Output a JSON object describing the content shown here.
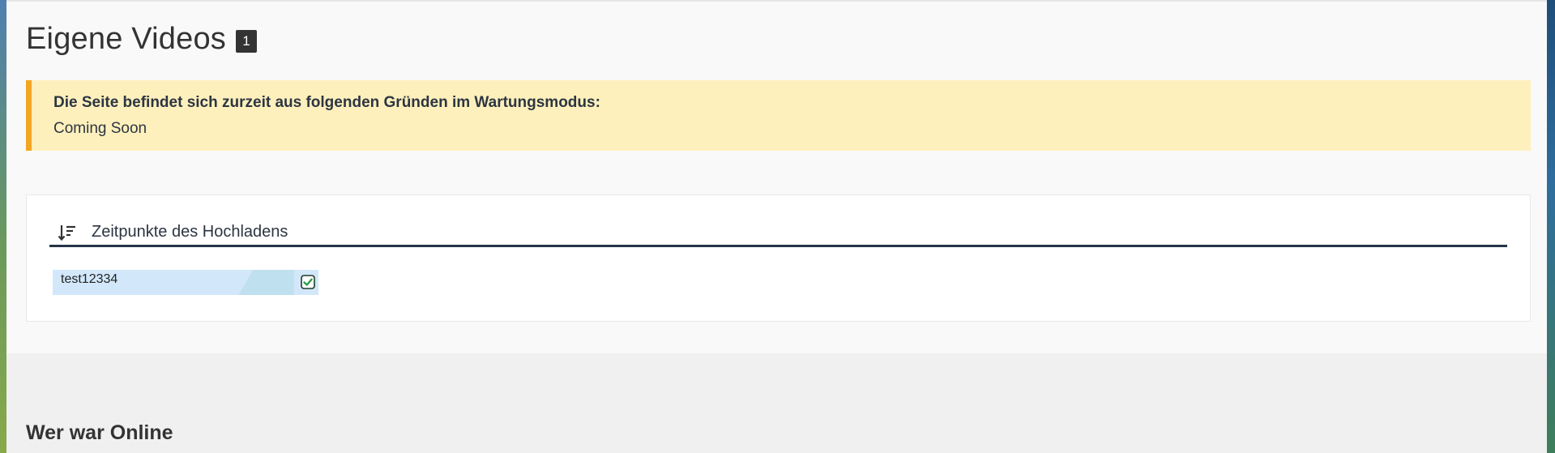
{
  "header": {
    "title": "Eigene Videos",
    "count": "1"
  },
  "alert": {
    "title": "Die Seite befindet sich zurzeit aus folgenden Gründen im Wartungsmodus:",
    "message": "Coming Soon"
  },
  "videos": {
    "sort_label": "Zeitpunkte des Hochladens",
    "sort_icon": "sort-descending-icon",
    "items": [
      {
        "name": "test12334",
        "checked": true
      }
    ]
  },
  "footer": {
    "title": "Wer war Online"
  },
  "colors": {
    "alert_bg": "#fef0bc",
    "alert_border": "#f4a623",
    "sort_underline": "#253447",
    "item_bg": "#d2e8fa",
    "check_green": "#2e9e4a"
  }
}
